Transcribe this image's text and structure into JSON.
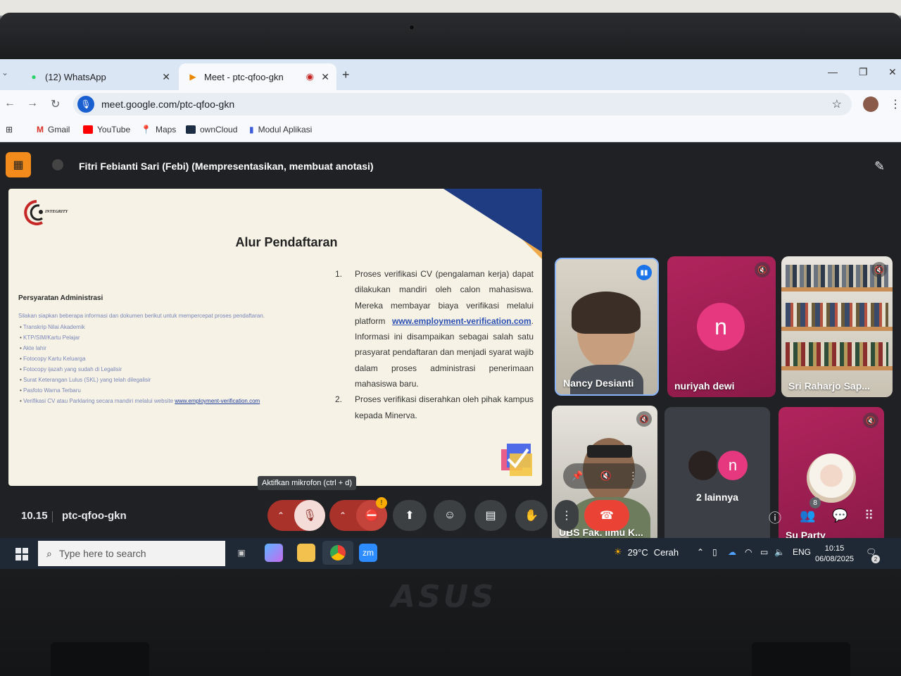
{
  "browser": {
    "tabs": [
      {
        "label": "(12) WhatsApp"
      },
      {
        "label": "Meet - ptc-qfoo-gkn"
      }
    ],
    "url": "meet.google.com/ptc-qfoo-gkn",
    "bookmarks": [
      "Gmail",
      "YouTube",
      "Maps",
      "ownCloud",
      "Modul Aplikasi"
    ]
  },
  "meet": {
    "presenter_label": "Fitri Febianti Sari (Febi) (Mempresentasikan, membuat anotasi)",
    "slide": {
      "title": "Alur Pendaftaran",
      "logo_text": "INTEGRITY",
      "requirements_heading": "Persyaratan Administrasi",
      "requirements_intro": "Silakan siapkan beberapa informasi dan dokumen berikut untuk mempercepat proses pendaftaran.",
      "requirements": [
        "Transkrip Nilai Akademik",
        "KTP/SIM/Kartu Pelajar",
        "Akte lahir",
        "Fotocopy Kartu Keluarga",
        "Fotocopy ijazah yang sudah di Legalisir",
        "Surat Keterangan Lulus (SKL) yang telah dilegalisir",
        "Pasfoto Warna Terbaru"
      ],
      "requirement_last_prefix": "Verifikasi CV atau Parklaring secara mandiri melalui website",
      "requirement_last_link": "www.employment-verification.com",
      "step1_num": "1.",
      "step1_text": "Proses verifikasi CV (pengalaman kerja) dapat dilakukan mandiri oleh calon mahasiswa. Mereka membayar biaya verifikasi melalui platform",
      "step1_link": "www.employment-verification.com",
      "step1_after": "Informasi ini disampaikan sebagai salah satu prasyarat pendaftaran dan menjadi syarat wajib dalam proses administrasi penerimaan mahasiswa baru.",
      "step2_num": "2.",
      "step2_text": "Proses verifikasi diserahkan oleh pihak kampus kepada Minerva."
    },
    "participants": [
      {
        "name": "Nancy Desianti"
      },
      {
        "name": "nuriyah dewi",
        "initial": "n"
      },
      {
        "name": "Sri Raharjo Sap..."
      },
      {
        "name": "UBS Fak. Ilmu K..."
      },
      {
        "name": "2 lainnya",
        "initial": "n"
      },
      {
        "name": "Su Party"
      }
    ],
    "time": "10.15",
    "meeting_code": "ptc-qfoo-gkn",
    "tooltip": "Aktifkan mikrofon (ctrl + d)",
    "people_count": "8",
    "camera_alert": "!"
  },
  "taskbar": {
    "search_placeholder": "Type here to search",
    "weather_temp": "29°C",
    "weather_desc": "Cerah",
    "lang": "ENG",
    "time": "10:15",
    "date": "06/08/2025",
    "notif_count": "2"
  },
  "laptop_brand": "ASUS",
  "colors": {
    "meet_bg": "#202124",
    "end_call": "#ea4335",
    "muted_red": "#a9322b",
    "avatar_pink": "#e5387f"
  }
}
